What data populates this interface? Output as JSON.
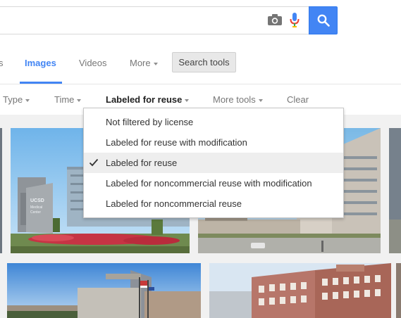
{
  "tabs": [
    {
      "label": "s"
    },
    {
      "label": "Images"
    },
    {
      "label": "Videos"
    },
    {
      "label": "More"
    }
  ],
  "search_tools_label": "Search tools",
  "tools": [
    {
      "label": "Type"
    },
    {
      "label": "Time"
    },
    {
      "label": "Labeled for reuse"
    },
    {
      "label": "More tools"
    },
    {
      "label": "Clear"
    }
  ],
  "license_menu": {
    "items": [
      {
        "label": "Not filtered by license"
      },
      {
        "label": "Labeled for reuse with modification"
      },
      {
        "label": "Labeled for reuse"
      },
      {
        "label": "Labeled for noncommercial reuse with modification"
      },
      {
        "label": "Labeled for noncommercial reuse"
      }
    ],
    "selected_index": 2
  },
  "image_sign_text": "UCSD Medical Center",
  "colors": {
    "accent": "#4285f4",
    "tab_text": "#777777",
    "active_tool": "#222222",
    "menu_selected_bg": "#eeeeee"
  }
}
